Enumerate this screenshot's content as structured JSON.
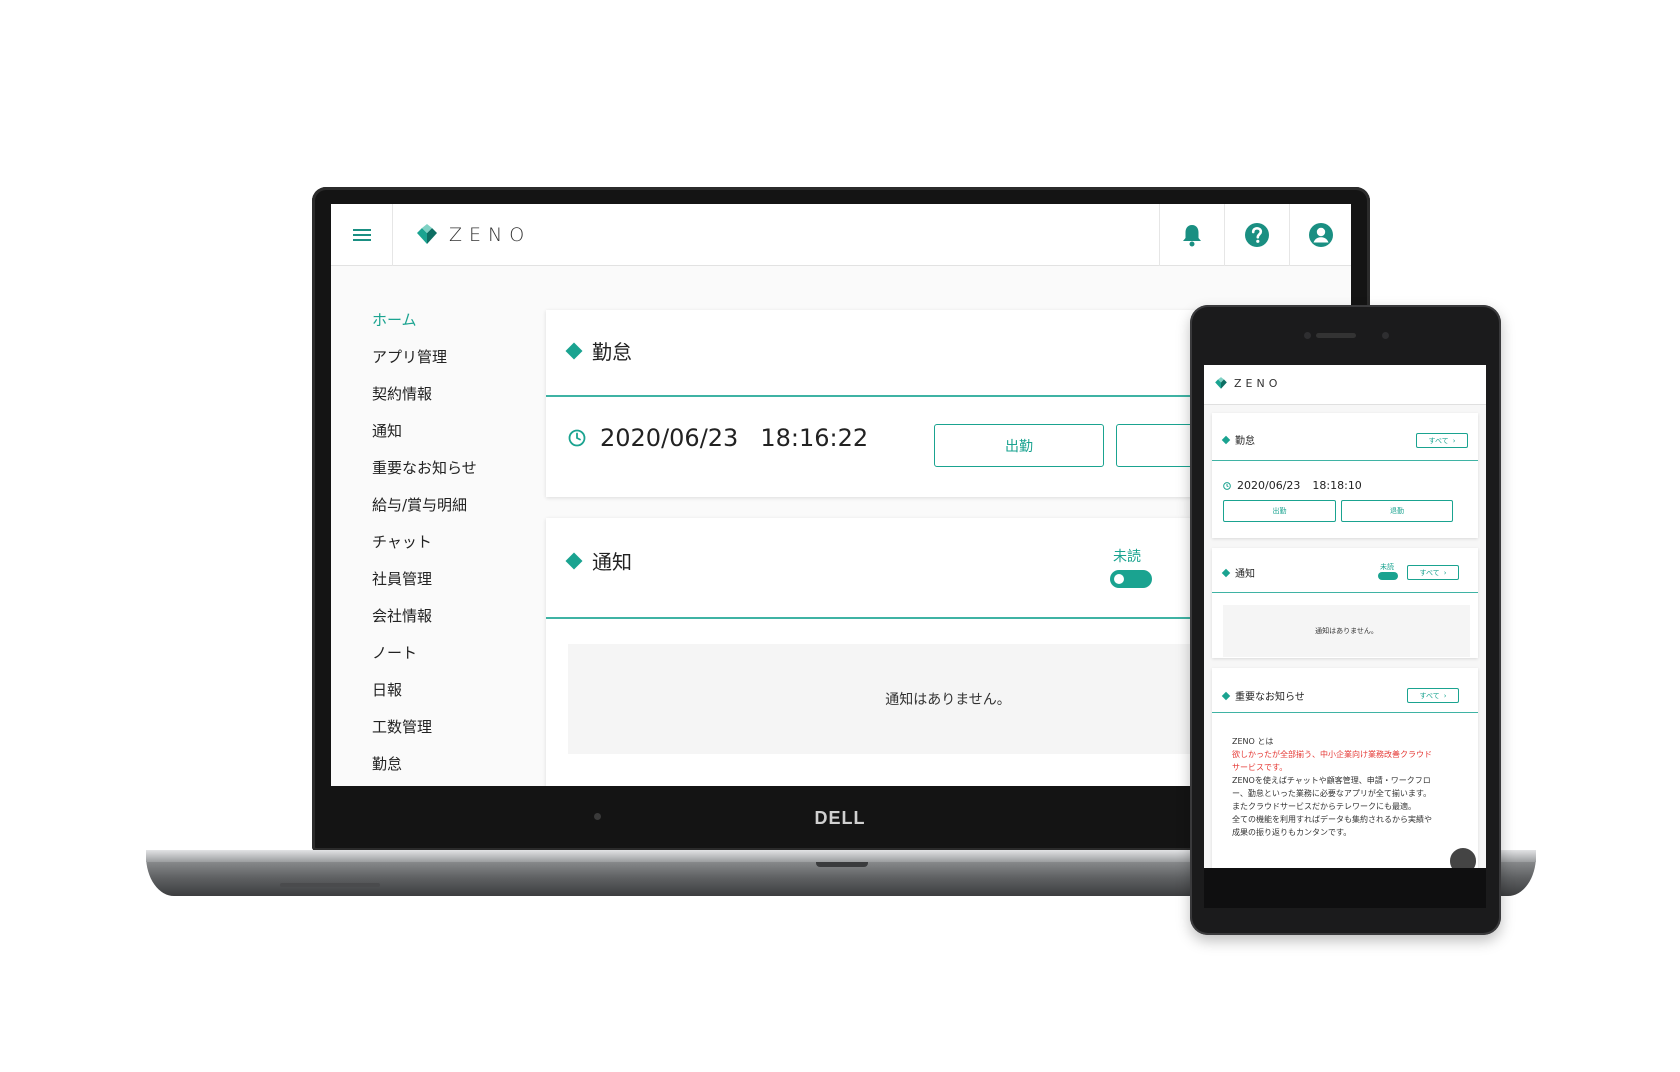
{
  "brand": {
    "name": "ZENO",
    "color": "#1aa390"
  },
  "laptop": {
    "maker_logo": "DELL",
    "topbar": {
      "icons": [
        "bell-icon",
        "help-icon",
        "account-icon"
      ]
    },
    "sidebar": {
      "items": [
        {
          "label": "ホーム",
          "active": true
        },
        {
          "label": "アプリ管理"
        },
        {
          "label": "契約情報"
        },
        {
          "label": "通知"
        },
        {
          "label": "重要なお知らせ"
        },
        {
          "label": "給与/賞与明細"
        },
        {
          "label": "チャット"
        },
        {
          "label": "社員管理"
        },
        {
          "label": "会社情報"
        },
        {
          "label": "ノート"
        },
        {
          "label": "日報"
        },
        {
          "label": "工数管理"
        },
        {
          "label": "勤怠"
        }
      ]
    },
    "attendance": {
      "title": "勤怠",
      "date": "2020/06/23",
      "time": "18:16:22",
      "clock_in_label": "出勤"
    },
    "notifications": {
      "title": "通知",
      "toggle_label": "未読",
      "empty_text": "通知はありません。"
    }
  },
  "phone": {
    "attendance": {
      "title": "勤怠",
      "all_label": "すべて",
      "date": "2020/06/23",
      "time": "18:18:10",
      "clock_in_label": "出勤",
      "clock_out_label": "退勤"
    },
    "notifications": {
      "title": "通知",
      "toggle_label": "未読",
      "all_label": "すべて",
      "empty_text": "通知はありません。"
    },
    "announcements": {
      "title": "重要なお知らせ",
      "all_label": "すべて",
      "lines": [
        {
          "text": "ZENO とは",
          "style": "normal"
        },
        {
          "text": "欲しかったが全部揃う、中小企業向け業務改善クラウド",
          "style": "red"
        },
        {
          "text": "サービスです。",
          "style": "red"
        },
        {
          "text": "ZENOを使えばチャットや顧客管理、申請・ワークフロ",
          "style": "normal"
        },
        {
          "text": "ー、勤怠といった業務に必要なアプリが全て揃います。",
          "style": "normal"
        },
        {
          "text": "またクラウドサービスだからテレワークにも最適。",
          "style": "normal"
        },
        {
          "text": "全ての機能を利用すればデータも集約されるから実績や",
          "style": "normal"
        },
        {
          "text": "成果の振り返りもカンタンです。",
          "style": "normal"
        }
      ]
    }
  }
}
